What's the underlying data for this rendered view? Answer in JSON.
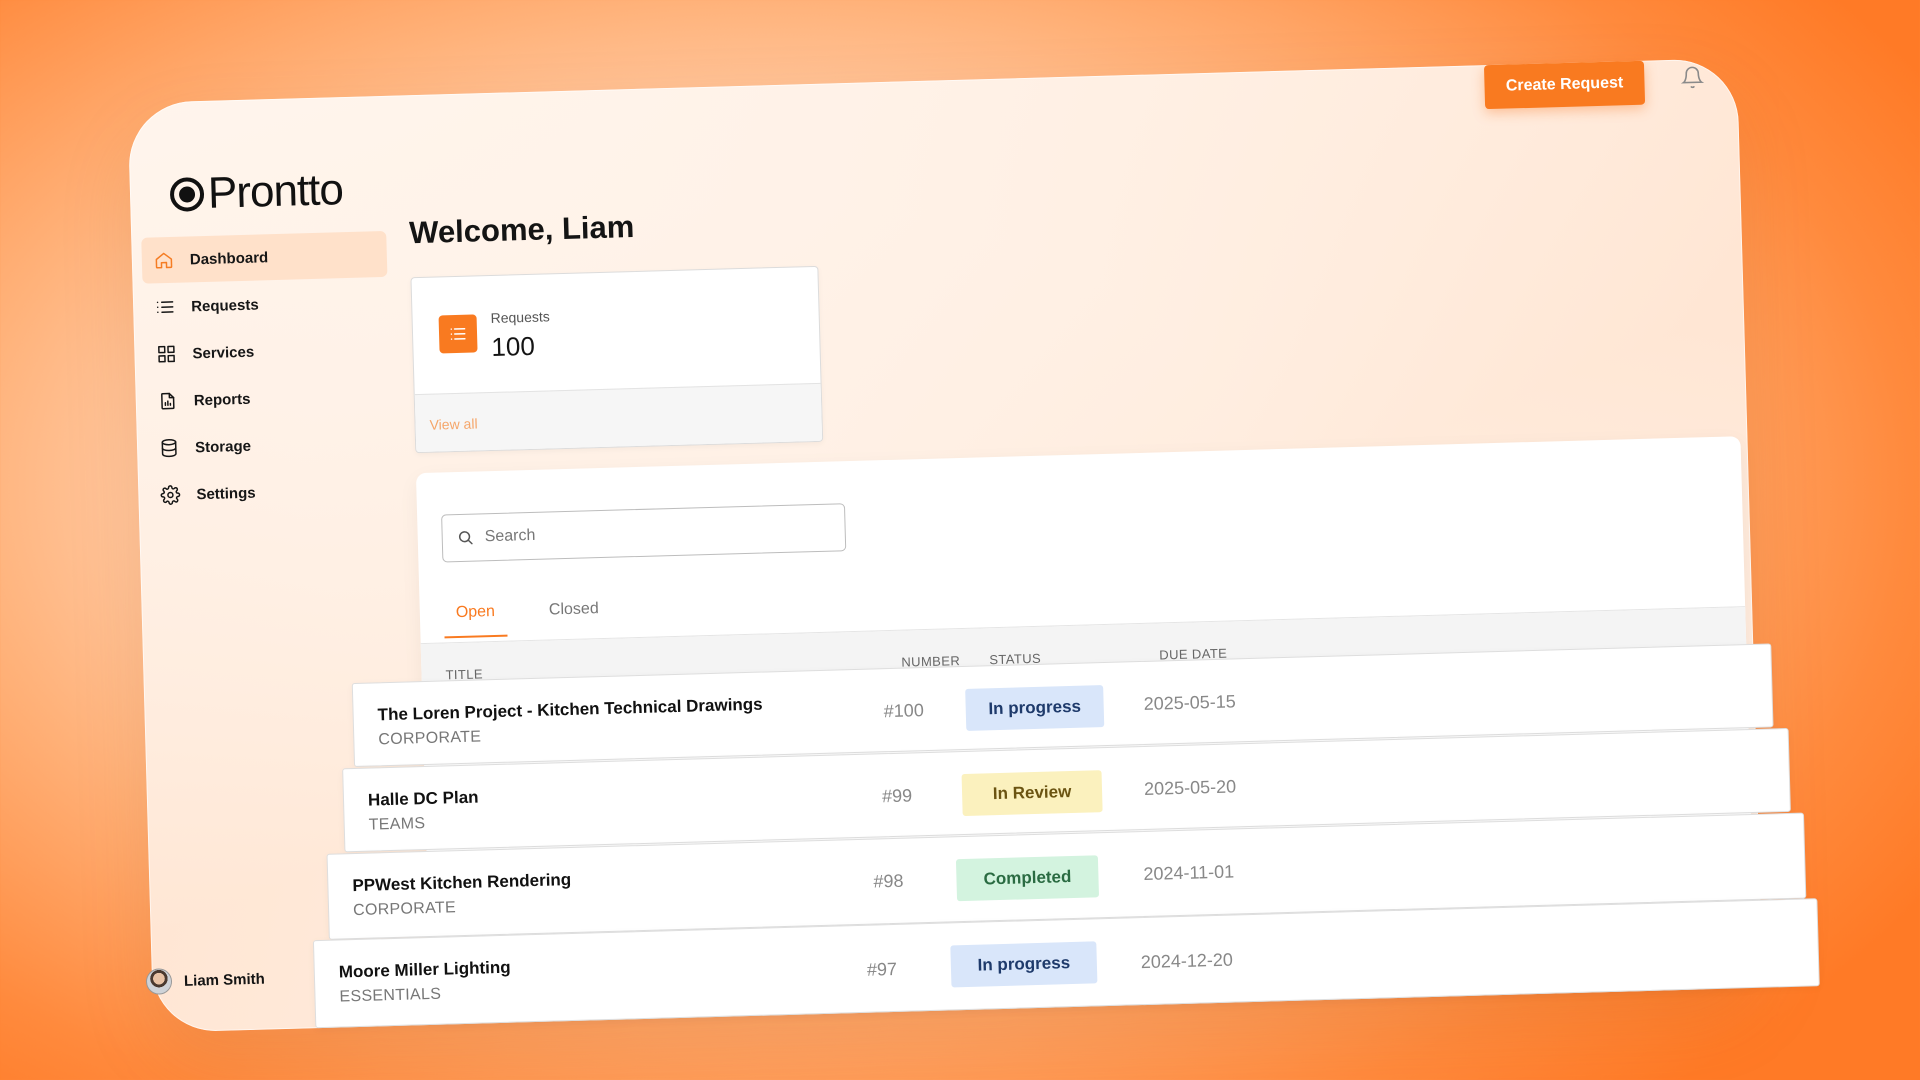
{
  "brand": {
    "name": "Prontto"
  },
  "header": {
    "create_label": "Create Request"
  },
  "sidebar": {
    "items": [
      {
        "label": "Dashboard",
        "icon": "home-icon",
        "active": true
      },
      {
        "label": "Requests",
        "icon": "list-icon"
      },
      {
        "label": "Services",
        "icon": "grid-icon"
      },
      {
        "label": "Reports",
        "icon": "report-icon"
      },
      {
        "label": "Storage",
        "icon": "database-icon"
      },
      {
        "label": "Settings",
        "icon": "gear-icon"
      }
    ]
  },
  "user": {
    "name": "Liam Smith"
  },
  "welcome": "Welcome, Liam",
  "stat_card": {
    "label": "Requests",
    "value": "100",
    "link": "View all"
  },
  "search": {
    "placeholder": "Search"
  },
  "tabs": [
    {
      "label": "Open",
      "active": true
    },
    {
      "label": "Closed"
    }
  ],
  "table": {
    "headers": {
      "title": "TITLE",
      "number": "NUMBER",
      "status": "STATUS",
      "due": "DUE DATE"
    },
    "rows": [
      {
        "title": "The Loren Project - Kitchen Technical Drawings",
        "category": "CORPORATE",
        "number": "#100",
        "status": "In progress",
        "due": "2025-05-15"
      },
      {
        "title": "Halle DC Plan",
        "category": "TEAMS",
        "number": "#99",
        "status": "In Review",
        "due": "2025-05-20"
      },
      {
        "title": "PPWest Kitchen Rendering",
        "category": "CORPORATE",
        "number": "#98",
        "status": "Completed",
        "due": "2024-11-01"
      },
      {
        "title": "Moore Miller Lighting",
        "category": "ESSENTIALS",
        "number": "#97",
        "status": "In progress",
        "due": "2024-12-20"
      }
    ]
  },
  "colors": {
    "accent": "#f97a20",
    "status_in_progress_bg": "#d9e6fa",
    "status_in_progress_fg": "#1e3a6b",
    "status_in_review_bg": "#fbf1be",
    "status_in_review_fg": "#6b5412",
    "status_completed_bg": "#d3f3df",
    "status_completed_fg": "#2a6b42"
  }
}
